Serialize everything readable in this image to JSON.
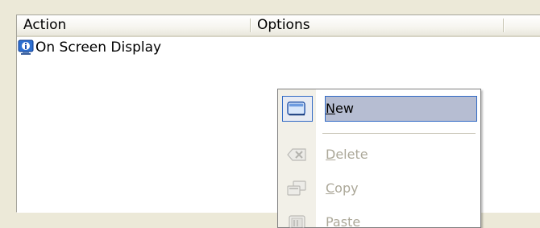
{
  "listview": {
    "columns": [
      {
        "label": "Action"
      },
      {
        "label": "Options"
      },
      {
        "label": ""
      }
    ],
    "rows": [
      {
        "label": "On Screen Display",
        "icon": "monitor-info-icon"
      }
    ]
  },
  "context_menu": {
    "items": [
      {
        "label_prefix": "",
        "accel": "N",
        "label_rest": "ew",
        "icon": "new-window-icon",
        "enabled": true,
        "highlighted": true
      },
      {
        "label_prefix": "",
        "accel": "D",
        "label_rest": "elete",
        "icon": "delete-icon",
        "enabled": false
      },
      {
        "label_prefix": "",
        "accel": "C",
        "label_rest": "opy",
        "icon": "copy-icon",
        "enabled": false
      },
      {
        "label_prefix": "",
        "accel": "",
        "label_rest": "Paste",
        "icon": "paste-icon",
        "enabled": false
      }
    ]
  },
  "colors": {
    "highlight_fill": "#b6bdd2",
    "highlight_border": "#316ac5",
    "disabled_text": "#aca899",
    "window_bg": "#ece9d8"
  }
}
